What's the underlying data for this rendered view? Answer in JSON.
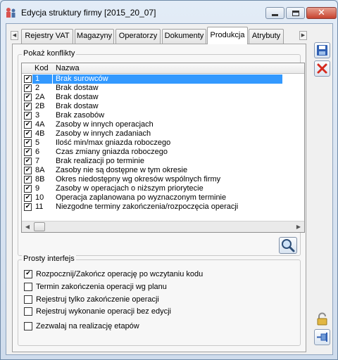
{
  "window": {
    "title": "Edycja struktury firmy [2015_20_07]"
  },
  "tabs": [
    {
      "label": "Rejestry VAT",
      "active": false
    },
    {
      "label": "Magazyny",
      "active": false
    },
    {
      "label": "Operatorzy",
      "active": false
    },
    {
      "label": "Dokumenty",
      "active": false
    },
    {
      "label": "Produkcja",
      "active": true
    },
    {
      "label": "Atrybuty",
      "active": false
    }
  ],
  "conflicts": {
    "legend": "Pokaż konflikty",
    "columns": {
      "code": "Kod",
      "name": "Nazwa"
    },
    "rows": [
      {
        "checked": true,
        "code": "1",
        "name": "Brak surowców",
        "selected": true
      },
      {
        "checked": true,
        "code": "2",
        "name": "Brak dostaw"
      },
      {
        "checked": true,
        "code": "2A",
        "name": "Brak dostaw"
      },
      {
        "checked": true,
        "code": "2B",
        "name": "Brak dostaw"
      },
      {
        "checked": true,
        "code": "3",
        "name": "Brak zasobów"
      },
      {
        "checked": true,
        "code": "4A",
        "name": "Zasoby w innych operacjach"
      },
      {
        "checked": true,
        "code": "4B",
        "name": "Zasoby w innych zadaniach"
      },
      {
        "checked": true,
        "code": "5",
        "name": "Ilość min/max gniazda roboczego"
      },
      {
        "checked": true,
        "code": "6",
        "name": "Czas zmiany gniazda roboczego"
      },
      {
        "checked": true,
        "code": "7",
        "name": "Brak realizacji po terminie"
      },
      {
        "checked": true,
        "code": "8A",
        "name": "Zasoby nie są dostępne w tym okresie"
      },
      {
        "checked": true,
        "code": "8B",
        "name": "Okres niedostępny wg okresów wspólnych firmy"
      },
      {
        "checked": true,
        "code": "9",
        "name": "Zasoby w operacjach o niższym priorytecie"
      },
      {
        "checked": true,
        "code": "10",
        "name": "Operacja zaplanowana po wyznaczonym terminie"
      },
      {
        "checked": true,
        "code": "11",
        "name": "Niezgodne terminy zakończenia/rozpoczęcia operacji"
      }
    ]
  },
  "simple_interface": {
    "legend": "Prosty interfejs",
    "options": [
      {
        "label": "Rozpocznij/Zakończ operację po wczytaniu kodu",
        "checked": true
      },
      {
        "label": "Termin zakończenia operacji wg planu",
        "checked": false
      },
      {
        "label": "Rejestruj tylko zakończenie operacji",
        "checked": false
      },
      {
        "label": "Rejestruj wykonanie operacji bez edycji",
        "checked": false
      },
      {
        "label": "Zezwalaj na realizację etapów",
        "checked": false
      }
    ]
  },
  "colors": {
    "selection": "#3399ff",
    "window_frame": "#cfdcec"
  },
  "icons": {
    "save": "floppy-disk",
    "cancel": "red-x",
    "lock": "padlock",
    "pin": "pin",
    "search": "magnifier"
  }
}
